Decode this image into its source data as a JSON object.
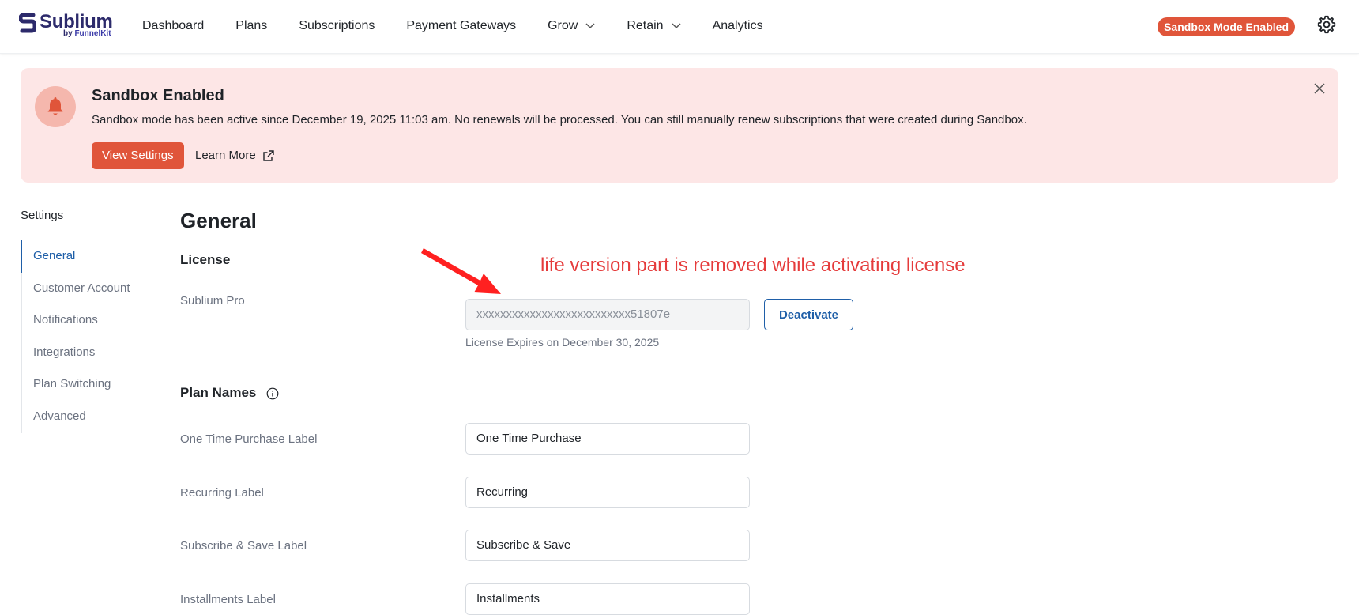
{
  "app": {
    "logo_text": "Sublium",
    "logo_sub_by": "by",
    "logo_sub_brand": "FunnelKit"
  },
  "nav": {
    "items": [
      {
        "label": "Dashboard",
        "has_dropdown": false
      },
      {
        "label": "Plans",
        "has_dropdown": false
      },
      {
        "label": "Subscriptions",
        "has_dropdown": false
      },
      {
        "label": "Payment Gateways",
        "has_dropdown": false
      },
      {
        "label": "Grow",
        "has_dropdown": true
      },
      {
        "label": "Retain",
        "has_dropdown": true
      },
      {
        "label": "Analytics",
        "has_dropdown": false
      }
    ],
    "sandbox_badge": "Sandbox Mode Enabled",
    "settings_icon": "gear-icon"
  },
  "banner": {
    "title": "Sandbox Enabled",
    "message": "Sandbox mode has been active since December 19, 2025 11:03 am. No renewals will be processed. You can still manually renew subscriptions that were created during Sandbox.",
    "primary_button": "View Settings",
    "link": "Learn More",
    "icon": "bell-icon",
    "background": "#fde6e6",
    "accent": "#e0553a"
  },
  "sidebar": {
    "title": "Settings",
    "items": [
      {
        "label": "General",
        "active": true
      },
      {
        "label": "Customer Account",
        "active": false
      },
      {
        "label": "Notifications",
        "active": false
      },
      {
        "label": "Integrations",
        "active": false
      },
      {
        "label": "Plan Switching",
        "active": false
      },
      {
        "label": "Advanced",
        "active": false
      }
    ]
  },
  "main": {
    "title": "General",
    "license": {
      "section_title": "License",
      "product_label": "Sublium Pro",
      "key_value": "xxxxxxxxxxxxxxxxxxxxxxxxxx51807e",
      "deactivate_button": "Deactivate",
      "expires_text": "License Expires on December 30, 2025"
    },
    "plan_names": {
      "section_title": "Plan Names",
      "fields": [
        {
          "label": "One Time Purchase Label",
          "value": "One Time Purchase"
        },
        {
          "label": "Recurring Label",
          "value": "Recurring"
        },
        {
          "label": "Subscribe & Save Label",
          "value": "Subscribe & Save"
        },
        {
          "label": "Installments Label",
          "value": "Installments"
        }
      ]
    }
  },
  "annotation": {
    "text": "life version part is removed while activating license",
    "color": "#e53b3b"
  }
}
